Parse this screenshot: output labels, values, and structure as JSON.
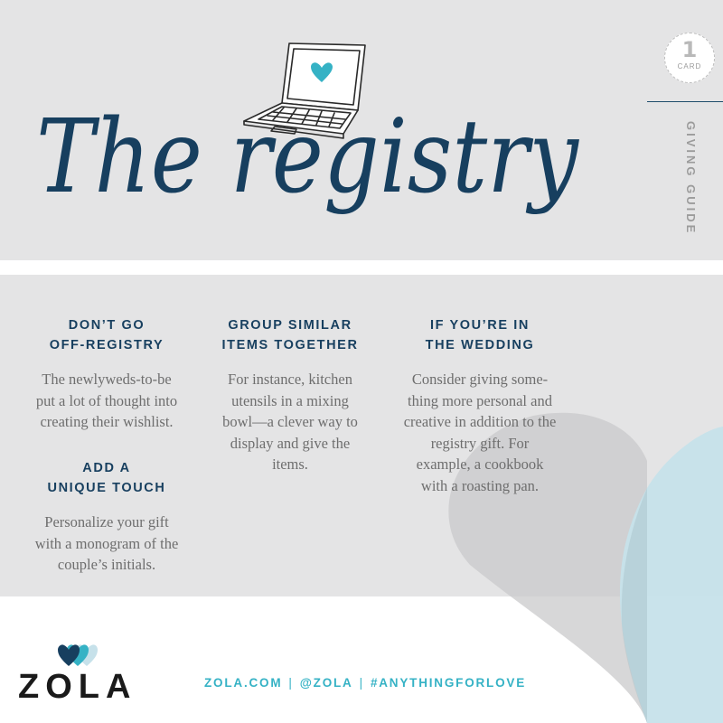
{
  "title": "The registry",
  "badge": {
    "number": "1",
    "word": "CARD"
  },
  "side_label": "GIVING GUIDE",
  "tips": [
    {
      "heading": [
        "DON’T GO",
        "OFF-REGISTRY"
      ],
      "body": [
        "The newlyweds-to-be",
        "put a lot of thought into",
        "creating their wishlist."
      ]
    },
    {
      "heading": [
        "GROUP SIMILAR",
        "ITEMS TOGETHER"
      ],
      "body": [
        "For instance, kitchen",
        "utensils in a mixing",
        "bowl—a clever way to",
        "display and give the",
        "items."
      ]
    },
    {
      "heading": [
        "IF YOU’RE IN",
        "THE WEDDING"
      ],
      "body": [
        "Consider giving some-",
        "thing more personal and",
        "creative in addition to the",
        "registry gift. For",
        "example, a cookbook",
        "with a roasting pan."
      ]
    },
    {
      "heading": [
        "ADD A",
        "UNIQUE TOUCH"
      ],
      "body": [
        "Personalize your gift",
        "with a monogram of the",
        "couple’s initials."
      ]
    }
  ],
  "logo": {
    "wordmark": "ZOLA"
  },
  "footer": {
    "links": [
      "ZOLA.COM",
      "@ZOLA",
      "#ANYTHINGFORLOVE"
    ],
    "separator": "|"
  },
  "icons": {
    "laptop": "laptop-heart-icon",
    "logo": "zola-hearts-icon"
  },
  "colors": {
    "navy": "#173f5f",
    "teal": "#35b2c5",
    "light_blue": "#c6e1ea",
    "gray_bg": "#e4e4e5",
    "body_text": "#6e6e6e"
  }
}
